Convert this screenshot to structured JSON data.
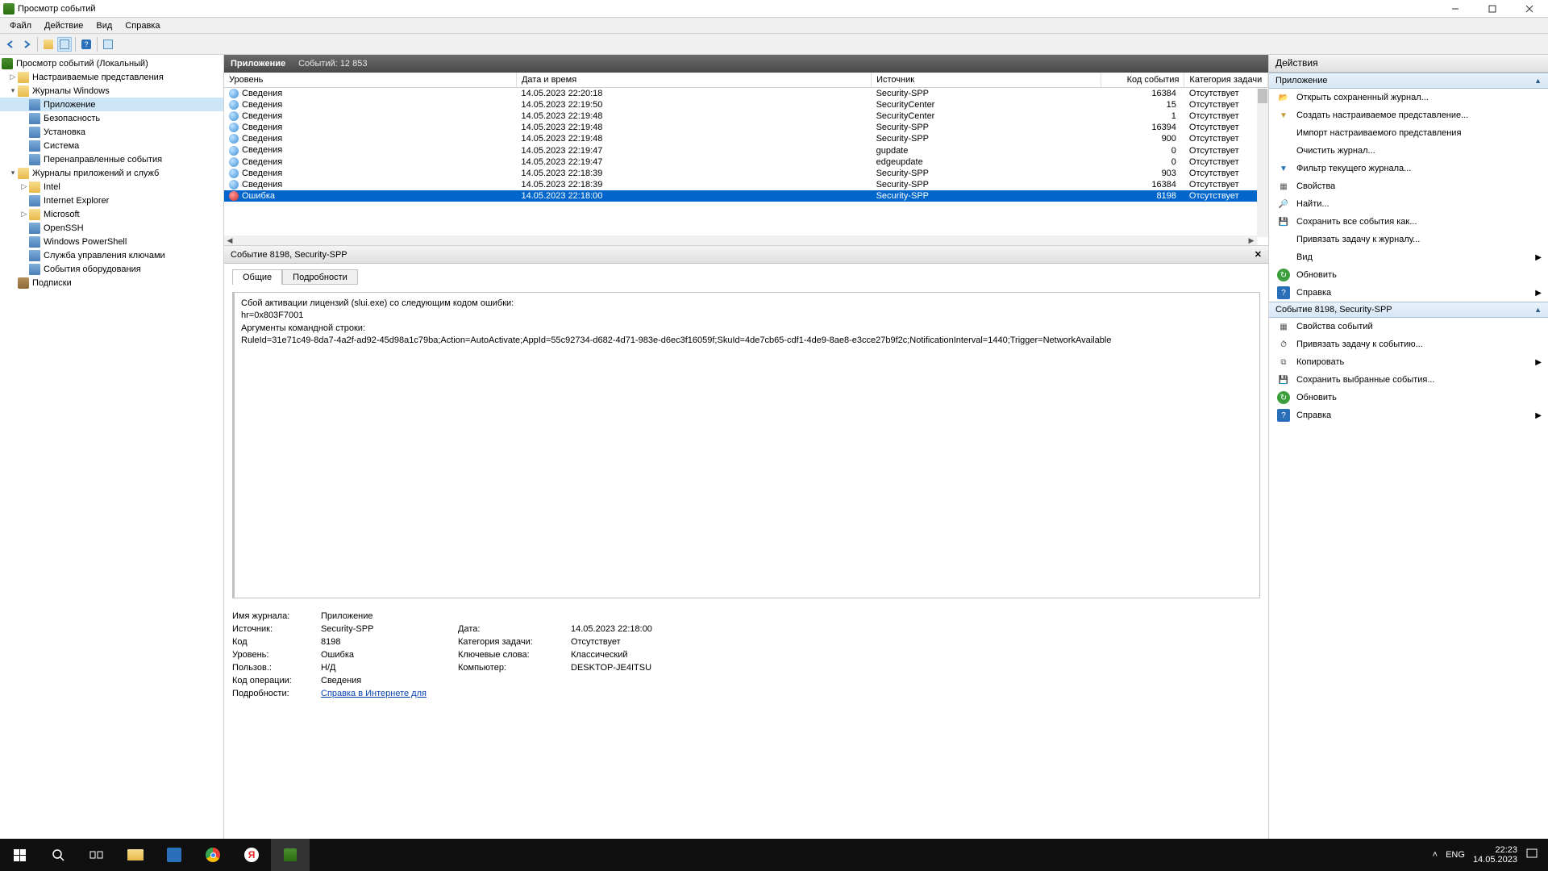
{
  "window": {
    "title": "Просмотр событий"
  },
  "menu": {
    "file": "Файл",
    "action": "Действие",
    "view": "Вид",
    "help": "Справка"
  },
  "tree": {
    "root": "Просмотр событий (Локальный)",
    "customViews": "Настраиваемые представления",
    "winLogs": "Журналы Windows",
    "app": "Приложение",
    "security": "Безопасность",
    "setup": "Установка",
    "system": "Система",
    "forwarded": "Перенаправленные события",
    "appSvcLogs": "Журналы приложений и служб",
    "intel": "Intel",
    "ie": "Internet Explorer",
    "microsoft": "Microsoft",
    "openssh": "OpenSSH",
    "powershell": "Windows PowerShell",
    "keymgmt": "Служба управления ключами",
    "hwevents": "События оборудования",
    "subscriptions": "Подписки"
  },
  "center": {
    "logName": "Приложение",
    "eventsLabel": "Событий: 12 853",
    "columns": {
      "level": "Уровень",
      "date": "Дата и время",
      "source": "Источник",
      "eventId": "Код события",
      "task": "Категория задачи"
    },
    "rows": [
      {
        "level": "Сведения",
        "icon": "info",
        "date": "14.05.2023 22:20:18",
        "source": "Security-SPP",
        "id": "16384",
        "task": "Отсутствует"
      },
      {
        "level": "Сведения",
        "icon": "info",
        "date": "14.05.2023 22:19:50",
        "source": "SecurityCenter",
        "id": "15",
        "task": "Отсутствует"
      },
      {
        "level": "Сведения",
        "icon": "info",
        "date": "14.05.2023 22:19:48",
        "source": "SecurityCenter",
        "id": "1",
        "task": "Отсутствует"
      },
      {
        "level": "Сведения",
        "icon": "info",
        "date": "14.05.2023 22:19:48",
        "source": "Security-SPP",
        "id": "16394",
        "task": "Отсутствует"
      },
      {
        "level": "Сведения",
        "icon": "info",
        "date": "14.05.2023 22:19:48",
        "source": "Security-SPP",
        "id": "900",
        "task": "Отсутствует"
      },
      {
        "level": "Сведения",
        "icon": "info",
        "date": "14.05.2023 22:19:47",
        "source": "gupdate",
        "id": "0",
        "task": "Отсутствует"
      },
      {
        "level": "Сведения",
        "icon": "info",
        "date": "14.05.2023 22:19:47",
        "source": "edgeupdate",
        "id": "0",
        "task": "Отсутствует"
      },
      {
        "level": "Сведения",
        "icon": "info",
        "date": "14.05.2023 22:18:39",
        "source": "Security-SPP",
        "id": "903",
        "task": "Отсутствует"
      },
      {
        "level": "Сведения",
        "icon": "info",
        "date": "14.05.2023 22:18:39",
        "source": "Security-SPP",
        "id": "16384",
        "task": "Отсутствует"
      },
      {
        "level": "Ошибка",
        "icon": "error",
        "date": "14.05.2023 22:18:00",
        "source": "Security-SPP",
        "id": "8198",
        "task": "Отсутствует",
        "selected": true
      }
    ]
  },
  "detail": {
    "header": "Событие 8198, Security-SPP",
    "tabs": {
      "general": "Общие",
      "details": "Подробности"
    },
    "message": {
      "line1": "Сбой активации лицензий (slui.exe) со следующим кодом ошибки:",
      "line2": "hr=0x803F7001",
      "line3": "Аргументы командной строки:",
      "line4": "RuleId=31e71c49-8da7-4a2f-ad92-45d98a1c79ba;Action=AutoActivate;AppId=55c92734-d682-4d71-983e-d6ec3f16059f;SkuId=4de7cb65-cdf1-4de9-8ae8-e3cce27b9f2c;NotificationInterval=1440;Trigger=NetworkAvailable"
    },
    "props": {
      "logNameLbl": "Имя журнала:",
      "logName": "Приложение",
      "sourceLbl": "Источник:",
      "source": "Security-SPP",
      "dateLbl": "Дата:",
      "date": "14.05.2023 22:18:00",
      "idLbl": "Код",
      "id": "8198",
      "taskLbl": "Категория задачи:",
      "task": "Отсутствует",
      "levelLbl": "Уровень:",
      "level": "Ошибка",
      "keywordsLbl": "Ключевые слова:",
      "keywords": "Классический",
      "userLbl": "Пользов.:",
      "user": "Н/Д",
      "computerLbl": "Компьютер:",
      "computer": "DESKTOP-JE4ITSU",
      "opcodeLbl": "Код операции:",
      "opcode": "Сведения",
      "moreInfoLbl": "Подробности:",
      "moreInfoLink": "Справка в Интернете для "
    }
  },
  "actions": {
    "paneTitle": "Действия",
    "section1": "Приложение",
    "openSaved": "Открыть сохраненный журнал...",
    "createCustom": "Создать настраиваемое представление...",
    "importCustom": "Импорт настраиваемого представления",
    "clearLog": "Очистить журнал...",
    "filterLog": "Фильтр текущего журнала...",
    "properties": "Свойства",
    "find": "Найти...",
    "saveAll": "Сохранить все события как...",
    "attachTask": "Привязать задачу к журналу...",
    "view": "Вид",
    "refresh": "Обновить",
    "help": "Справка",
    "section2": "Событие 8198, Security-SPP",
    "eventProps": "Свойства событий",
    "attachTaskEvent": "Привязать задачу к событию...",
    "copy": "Копировать",
    "saveSelected": "Сохранить выбранные события...",
    "refresh2": "Обновить",
    "help2": "Справка"
  },
  "taskbar": {
    "lang": "ENG",
    "time": "22:23",
    "date": "14.05.2023"
  }
}
